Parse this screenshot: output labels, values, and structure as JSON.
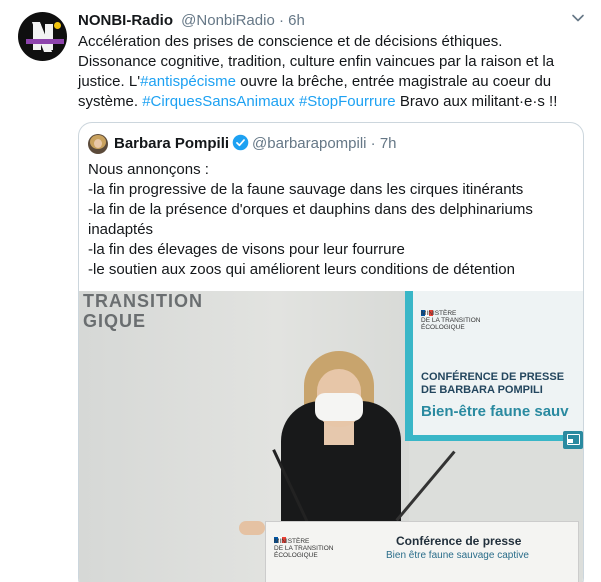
{
  "tweet": {
    "author_name": "NONBI-Radio",
    "author_handle": "@NonbiRadio",
    "separator": "·",
    "time": "6h",
    "text_before": "Accélération des prises de conscience et de décisions éthiques. Dissonance cognitive, tradition, culture enfin vaincues par la raison et la justice. L'",
    "hashtag1": "#antispécisme",
    "text_middle": " ouvre la brêche, entrée magistrale au coeur du système. ",
    "hashtag2": "#CirquesSansAnimaux",
    "space": " ",
    "hashtag3": "#StopFourrure",
    "text_after": " Bravo aux militant·e·s !!"
  },
  "quote": {
    "author_name": "Barbara Pompili",
    "author_handle": "@barbarapompili",
    "separator": "·",
    "time": "7h",
    "lines": [
      "Nous annonçons :",
      "-la fin progressive de la faune sauvage dans les cirques itinérants",
      "-la fin de la présence d'orques et dauphins dans des delphinariums",
      "inadaptés",
      "-la fin des élevages de visons pour leur fourrure",
      "-le soutien aux zoos qui améliorent leurs conditions de détention"
    ]
  },
  "media": {
    "wall_text_line1": "TRANSITION",
    "wall_text_line2": "GIQUE",
    "screen_ministry": "MINISTÈRE\nDE LA TRANSITION\nÉCOLOGIQUE",
    "screen_conference": "CONFÉRENCE DE PRESSE\nDE BARBARA POMPILI",
    "screen_title": "Bien-être faune sauv",
    "lectern_ministry": "MINISTÈRE\nDE LA TRANSITION\nÉCOLOGIQUE",
    "lectern_title": "Conférence de presse",
    "lectern_subtitle": "Bien être faune sauvage captive"
  },
  "colors": {
    "link": "#1da1f2",
    "secondary_text": "#657786",
    "border": "#ccd6dd",
    "verified": "#1da1f2"
  },
  "icons": {
    "menu": "chevron-down-icon",
    "verified": "verified-badge-icon",
    "fullscreen": "picture-in-picture-icon"
  }
}
